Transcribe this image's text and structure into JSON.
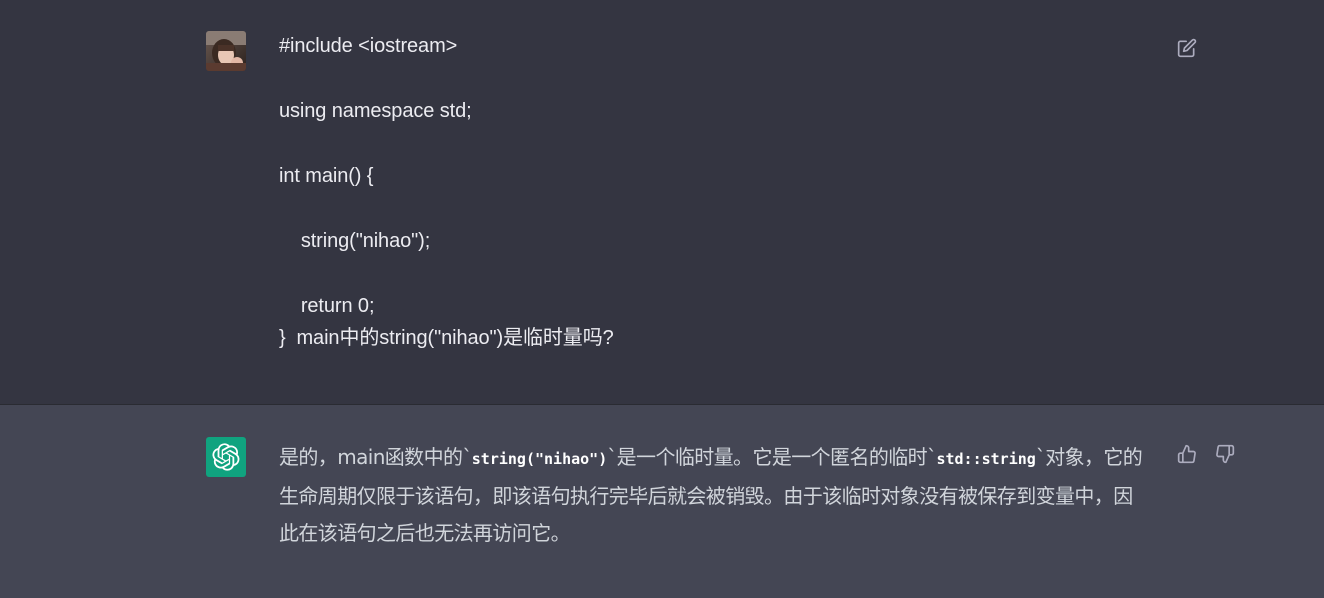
{
  "user_message": {
    "lines": [
      "#include <iostream>",
      "",
      "using namespace std;",
      "",
      "int main() {",
      "",
      "    string(\"nihao\");",
      "",
      "    return 0;",
      "}  main中的string(\"nihao\")是临时量吗?"
    ]
  },
  "assistant_message": {
    "segments": [
      {
        "type": "text",
        "value": "是的，main函数中的`"
      },
      {
        "type": "code",
        "value": "string(\"nihao\")"
      },
      {
        "type": "text",
        "value": "`是一个临时量。它是一个匿名的临时`"
      },
      {
        "type": "code",
        "value": "std::string"
      },
      {
        "type": "text",
        "value": "`对象，它的生命周期仅限于该语句，即该语句执行完毕后就会被销毁。由于该临时对象没有被保存到变量中，因此在该语句之后也无法再访问它。"
      }
    ]
  },
  "icons": {
    "edit": "edit-icon",
    "thumbs_up": "thumbs-up-icon",
    "thumbs_down": "thumbs-down-icon",
    "openai_logo": "openai-logo-icon"
  },
  "colors": {
    "user_bg": "#343541",
    "assistant_bg": "#444654",
    "bot_avatar": "#10a37f"
  }
}
